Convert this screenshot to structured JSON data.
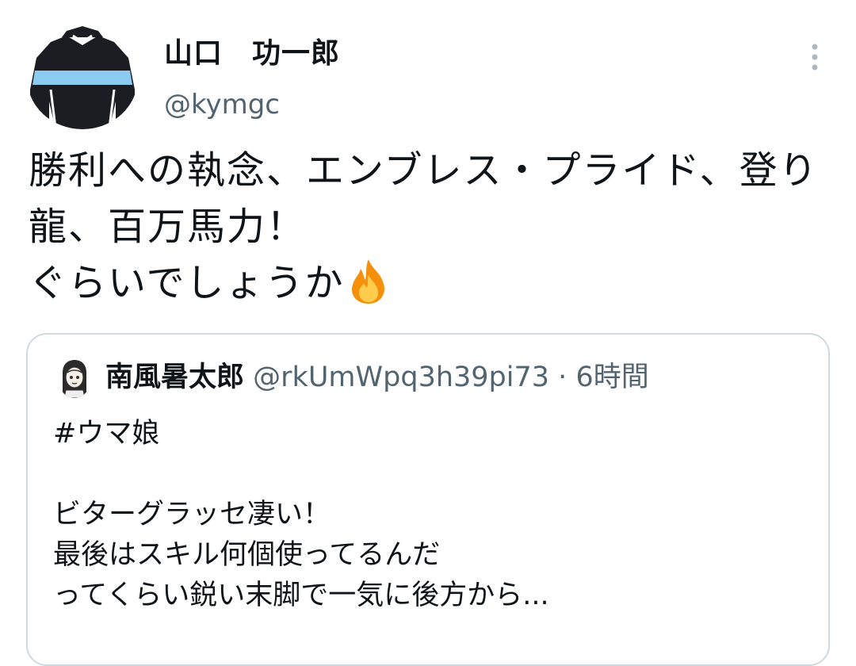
{
  "tweet": {
    "author": {
      "display_name": "山口　功一郎",
      "handle": "@kymgc",
      "avatar_icon": "jockey-silks-avatar"
    },
    "more_icon": "more-options-icon",
    "text": "勝利への執念、エンブレス・プライド、登り龍、百万馬力！\nぐらいでしょうか",
    "emoji": "fire-icon"
  },
  "quoted_tweet": {
    "author": {
      "display_name": "南風暑太郎",
      "handle": "@rkUmWpq3h39pi73",
      "avatar_icon": "character-avatar"
    },
    "separator": "·",
    "time": "6時間",
    "text": "#ウマ娘\n\nビターグラッセ凄い！\n最後はスキル何個使ってるんだ\nってくらい鋭い末脚で一気に後方から..."
  },
  "colors": {
    "text_primary": "#0f1419",
    "text_secondary": "#536471",
    "border": "#cfd9de",
    "silks_black": "#1c1d22",
    "silks_blue": "#8ccbf0"
  }
}
